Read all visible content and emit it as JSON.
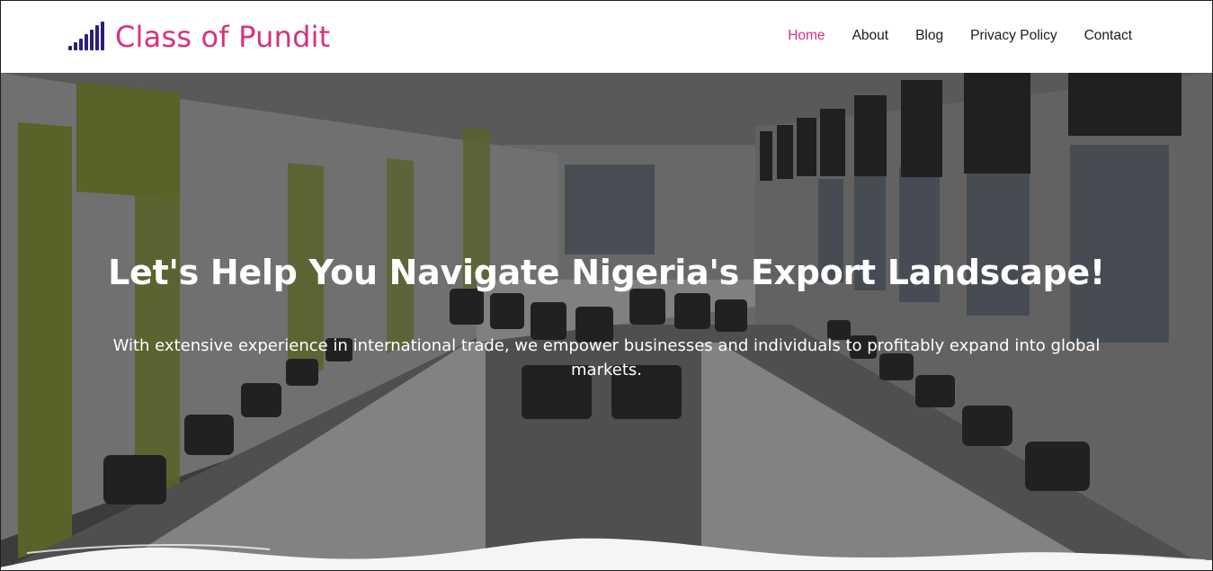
{
  "brand": {
    "name": "Class of Pundit",
    "logo_icon": "signal-bars-icon",
    "brand_color": "#d8317f",
    "logo_icon_color": "#2a1f7a"
  },
  "nav": {
    "items": [
      {
        "label": "Home",
        "active": true
      },
      {
        "label": "About",
        "active": false
      },
      {
        "label": "Blog",
        "active": false
      },
      {
        "label": "Privacy Policy",
        "active": false
      },
      {
        "label": "Contact",
        "active": false
      }
    ],
    "active_color": "#d8317f"
  },
  "hero": {
    "title": "Let's Help You Navigate Nigeria's Export Landscape!",
    "subtitle": "With extensive experience in international trade, we empower businesses and individuals to profitably expand into global markets.",
    "background_image": "conference-room-photo"
  }
}
